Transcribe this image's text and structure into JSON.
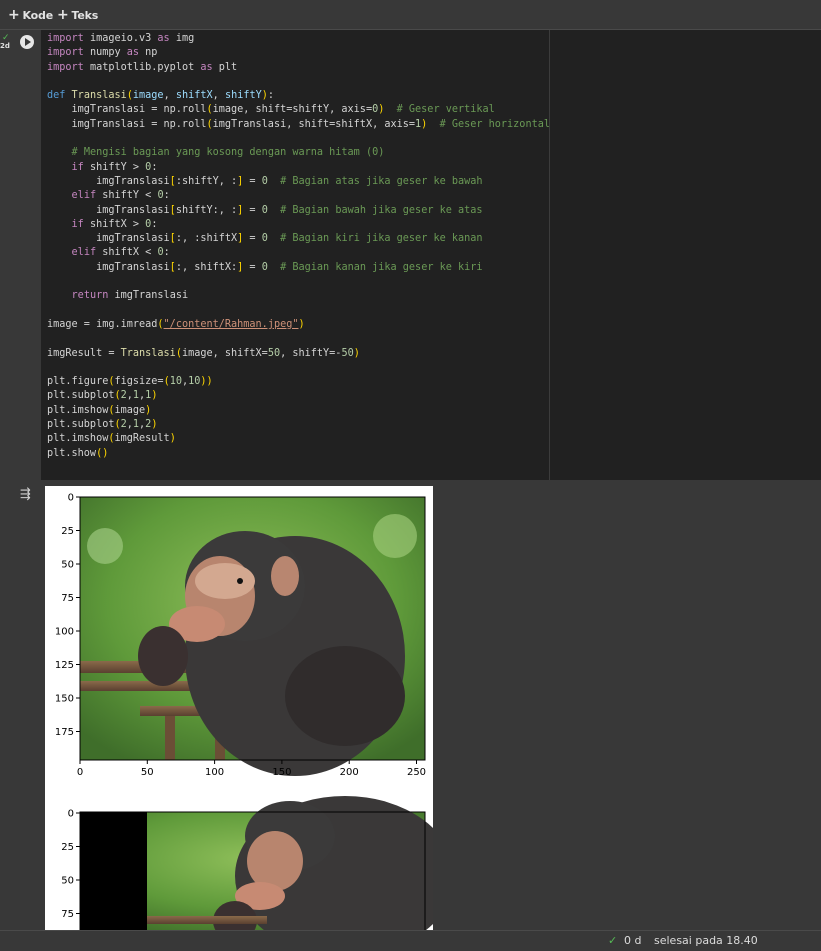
{
  "toolbar": {
    "code_label": "Kode",
    "text_label": "Teks"
  },
  "cell": {
    "exec_count": "2d",
    "run_status": "✓"
  },
  "code_lines": [
    "import imageio.v3 as img",
    "import numpy as np",
    "import matplotlib.pyplot as plt",
    "",
    "def Translasi(image, shiftX, shiftY):",
    "    imgTranslasi = np.roll(image, shift=shiftY, axis=0)  # Geser vertikal",
    "    imgTranslasi = np.roll(imgTranslasi, shift=shiftX, axis=1)  # Geser horizontal",
    "",
    "    # Mengisi bagian yang kosong dengan warna hitam (0)",
    "    if shiftY > 0:",
    "        imgTranslasi[:shiftY, :] = 0  # Bagian atas jika geser ke bawah",
    "    elif shiftY < 0:",
    "        imgTranslasi[shiftY:, :] = 0  # Bagian bawah jika geser ke atas",
    "    if shiftX > 0:",
    "        imgTranslasi[:, :shiftX] = 0  # Bagian kiri jika geser ke kanan",
    "    elif shiftX < 0:",
    "        imgTranslasi[:, shiftX:] = 0  # Bagian kanan jika geser ke kiri",
    "",
    "    return imgTranslasi",
    "",
    "image = img.imread(\"/content/Rahman.jpeg\")",
    "",
    "imgResult = Translasi(image, shiftX=50, shiftY=-50)",
    "",
    "plt.figure(figsize=(10,10))",
    "plt.subplot(2,1,1)",
    "plt.imshow(image)",
    "plt.subplot(2,1,2)",
    "plt.imshow(imgResult)",
    "plt.show()"
  ],
  "plot1": {
    "y_ticks": [
      "0",
      "25",
      "50",
      "75",
      "100",
      "125",
      "150",
      "175"
    ],
    "x_ticks": [
      "0",
      "50",
      "100",
      "150",
      "200",
      "250"
    ]
  },
  "plot2": {
    "y_ticks": [
      "0",
      "25",
      "50",
      "75"
    ]
  },
  "status": {
    "check": "✓",
    "duration": "0 d",
    "finished": "selesai pada 18.40"
  }
}
